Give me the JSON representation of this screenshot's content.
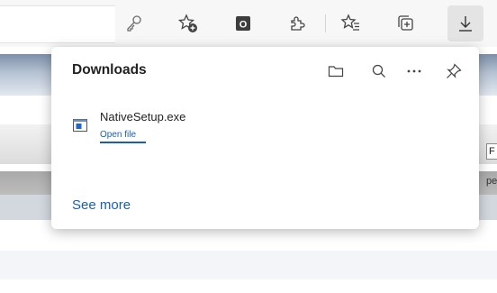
{
  "toolbar": {
    "icons": [
      "key-icon",
      "add-favorite-icon",
      "outlook-icon",
      "extensions-icon",
      "favorites-icon",
      "collections-icon",
      "downloads-icon"
    ],
    "outlook_letter": "O"
  },
  "page": {
    "field_char": "F",
    "partial_text": "pe"
  },
  "downloads": {
    "title": "Downloads",
    "items": [
      {
        "file_name": "NativeSetup.exe",
        "action": "Open file"
      }
    ],
    "see_more": "See more"
  },
  "colors": {
    "accent": "#1a5fb4",
    "flyout_bg": "#ffffff",
    "toolbar_bg": "#f7f7f7"
  }
}
